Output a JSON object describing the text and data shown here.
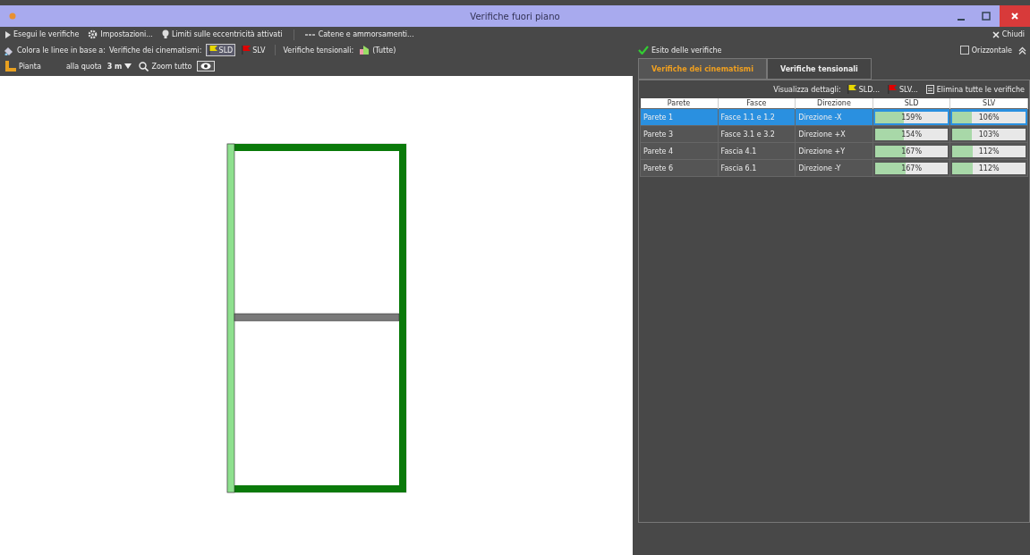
{
  "window": {
    "title": "Verifiche fuori piano"
  },
  "toolbar": {
    "row_1": [
      {
        "kind": "play",
        "label": "Esegui le verifiche"
      },
      {
        "kind": "gear",
        "label": "Impostazioni..."
      },
      {
        "kind": "bulb",
        "label": "Limiti sulle eccentricità attivati"
      },
      {
        "kind": "chain",
        "label": "Catene e ammorsamenti..."
      }
    ],
    "close_label": "Chiudi",
    "color_label": "Colora le linee in base a:",
    "cinematismi_label": "Verifiche dei cinematismi:",
    "flags": [
      {
        "label": "SLD",
        "selected": true,
        "color": "#e8d800"
      },
      {
        "label": "SLV",
        "selected": false,
        "color": "#e00000"
      }
    ],
    "tensional_label": "Verifiche tensionali:",
    "tensional_value": "(Tutte)",
    "view_label": "Pianta",
    "level_label": "alla quota",
    "level_value": "3 m",
    "zoom_label": "Zoom tutto"
  },
  "results": {
    "title": "Esito delle verifiche",
    "horizontal": {
      "label": "Orizzontale",
      "checked": false
    },
    "tabs": [
      {
        "label": "Verifiche dei cinematismi",
        "selected": true
      },
      {
        "label": "Verifiche tensionali",
        "selected": false
      }
    ],
    "details_label": "Visualizza dettagli:",
    "detail_buttons": [
      {
        "label": "SLD...",
        "color": "#e8d800"
      },
      {
        "label": "SLV...",
        "color": "#e00000"
      }
    ],
    "delete_label": "Elimina tutte le verifiche",
    "columns": [
      "Parete",
      "Fasce",
      "Direzione",
      "SLD",
      "SLV"
    ],
    "rows": [
      {
        "parete": "Parete 1",
        "fasce": "Fasce 1.1 e 1.2",
        "direzione": "Direzione -X",
        "sld": {
          "text": "159%",
          "level": 0.4
        },
        "slv": {
          "text": "106%",
          "level": 0.27
        },
        "selected": true
      },
      {
        "parete": "Parete 3",
        "fasce": "Fasce 3.1 e 3.2",
        "direzione": "Direzione +X",
        "sld": {
          "text": "154%",
          "level": 0.39
        },
        "slv": {
          "text": "103%",
          "level": 0.26
        },
        "selected": false
      },
      {
        "parete": "Parete 4",
        "fasce": "Fascia 4.1",
        "direzione": "Direzione +Y",
        "sld": {
          "text": "167%",
          "level": 0.42
        },
        "slv": {
          "text": "112%",
          "level": 0.28
        },
        "selected": false
      },
      {
        "parete": "Parete 6",
        "fasce": "Fascia 6.1",
        "direzione": "Direzione -Y",
        "sld": {
          "text": "167%",
          "level": 0.42
        },
        "slv": {
          "text": "112%",
          "level": 0.28
        },
        "selected": false
      }
    ]
  }
}
